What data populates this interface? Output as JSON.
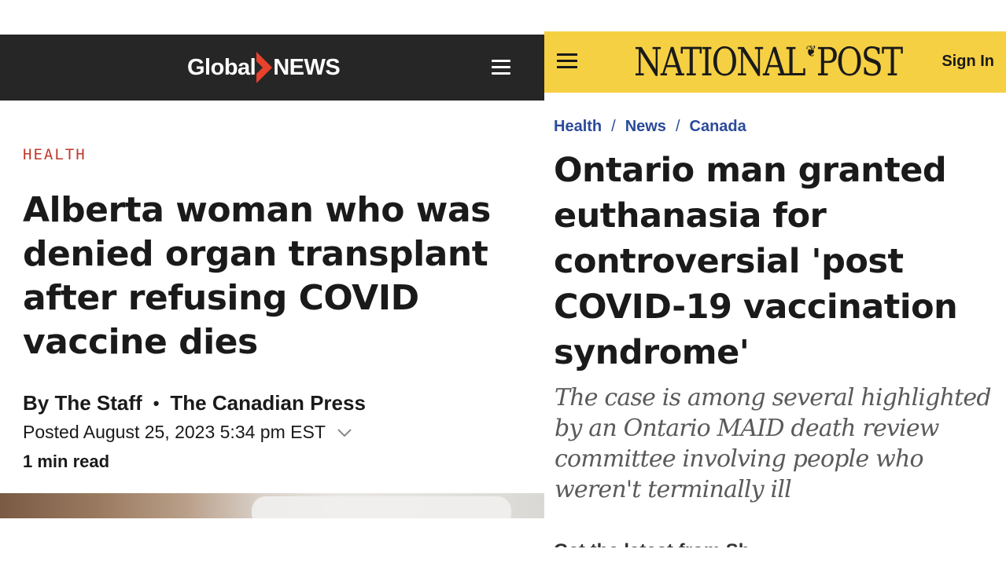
{
  "global_news": {
    "logo": {
      "left_word": "Global",
      "right_word": "NEWS",
      "accent_color": "#e8412c"
    },
    "menu_icon": "hamburger-menu-icon",
    "category": "HEALTH",
    "headline": "Alberta woman who was denied organ transplant after refusing COVID vaccine dies",
    "byline": {
      "author": "By The Staff",
      "separator": "•",
      "source": "The Canadian Press"
    },
    "posted": "Posted August 25, 2023 5:34 pm EST",
    "read_time": "1 min read",
    "colors": {
      "header_bg": "#262626",
      "category": "#c0392b"
    }
  },
  "national_post": {
    "logo": {
      "part1": "NATIONAL",
      "leaf_glyph": "❦",
      "part2": "POST"
    },
    "menu_icon": "hamburger-menu-icon",
    "sign_in": "Sign In",
    "breadcrumb": [
      "Health",
      "News",
      "Canada"
    ],
    "breadcrumb_separator": "/",
    "headline": "Ontario man granted euthanasia for controversial 'post COVID-19 vaccination syndrome'",
    "dek": "The case is among several highlighted by an Ontario MAID death review committee involving people who weren't terminally ill",
    "teaser_partial": "Get the latest from Sh...",
    "colors": {
      "header_bg": "#f6d043",
      "breadcrumb": "#2b4a9a",
      "dek": "#5a5a5a"
    }
  }
}
